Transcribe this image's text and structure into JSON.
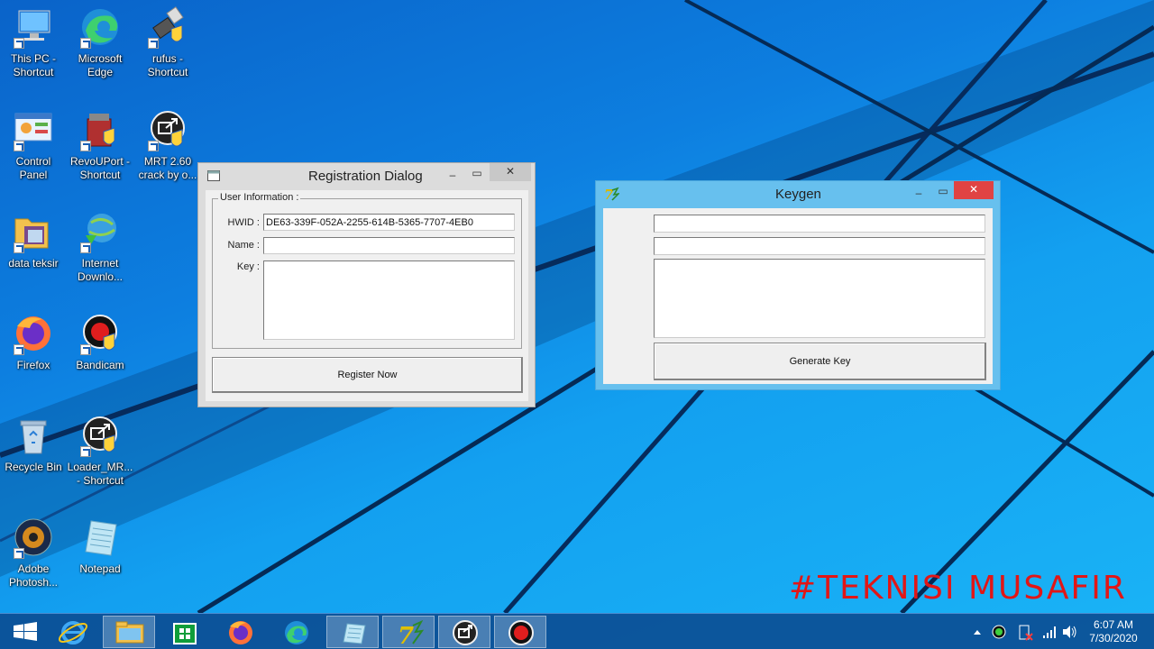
{
  "desktop": {
    "icons": [
      {
        "label": "This PC -\nShortcut",
        "icon": "this-pc-icon"
      },
      {
        "label": "Microsoft\nEdge",
        "icon": "edge-icon"
      },
      {
        "label": "rufus -\nShortcut",
        "icon": "rufus-icon"
      },
      {
        "label": "Control\nPanel",
        "icon": "control-panel-icon"
      },
      {
        "label": "RevoUPort -\nShortcut",
        "icon": "revouport-icon"
      },
      {
        "label": "MRT 2.60\ncrack by o...",
        "icon": "mrt-icon"
      },
      {
        "label": "data teksir",
        "icon": "folder-icon"
      },
      {
        "label": "Internet\nDownlo...",
        "icon": "idm-icon"
      },
      {
        "label": "Firefox",
        "icon": "firefox-icon"
      },
      {
        "label": "Bandicam",
        "icon": "bandicam-icon"
      },
      {
        "label": "Recycle Bin",
        "icon": "recycle-bin-icon"
      },
      {
        "label": "Loader_MR...\n- Shortcut",
        "icon": "loader-icon"
      },
      {
        "label": "Adobe\nPhotosh...",
        "icon": "photoshop-icon"
      },
      {
        "label": "Notepad",
        "icon": "notepad-icon"
      }
    ]
  },
  "registration_dialog": {
    "title": "Registration Dialog",
    "min": "‒",
    "max": "▭",
    "close": "✕",
    "group_label": "User Information :",
    "hwid_label": "HWID :",
    "hwid_value": "DE63-339F-052A-2255-614B-5365-7707-4EB0",
    "name_label": "Name :",
    "name_value": "",
    "key_label": "Key :",
    "key_value": "",
    "register_button": "Register Now"
  },
  "keygen": {
    "title": "Keygen",
    "min": "‒",
    "max": "▭",
    "close": "✕",
    "field1": "",
    "field2": "",
    "field3": "",
    "generate_button": "Generate Key"
  },
  "watermark": "#TEKNISI MUSAFIR",
  "taskbar": {
    "items": [
      "start-icon",
      "internet-explorer-icon",
      "file-explorer-icon",
      "store-icon",
      "firefox-icon",
      "edge-icon",
      "notepad-icon",
      "keygen-icon",
      "mrt-icon",
      "bandicam-icon"
    ],
    "time": "6:07 AM",
    "date": "7/30/2020"
  },
  "colors": {
    "watermark": "#e21616",
    "keygen_frame": "#67c0ee",
    "close_button": "#e04343"
  }
}
